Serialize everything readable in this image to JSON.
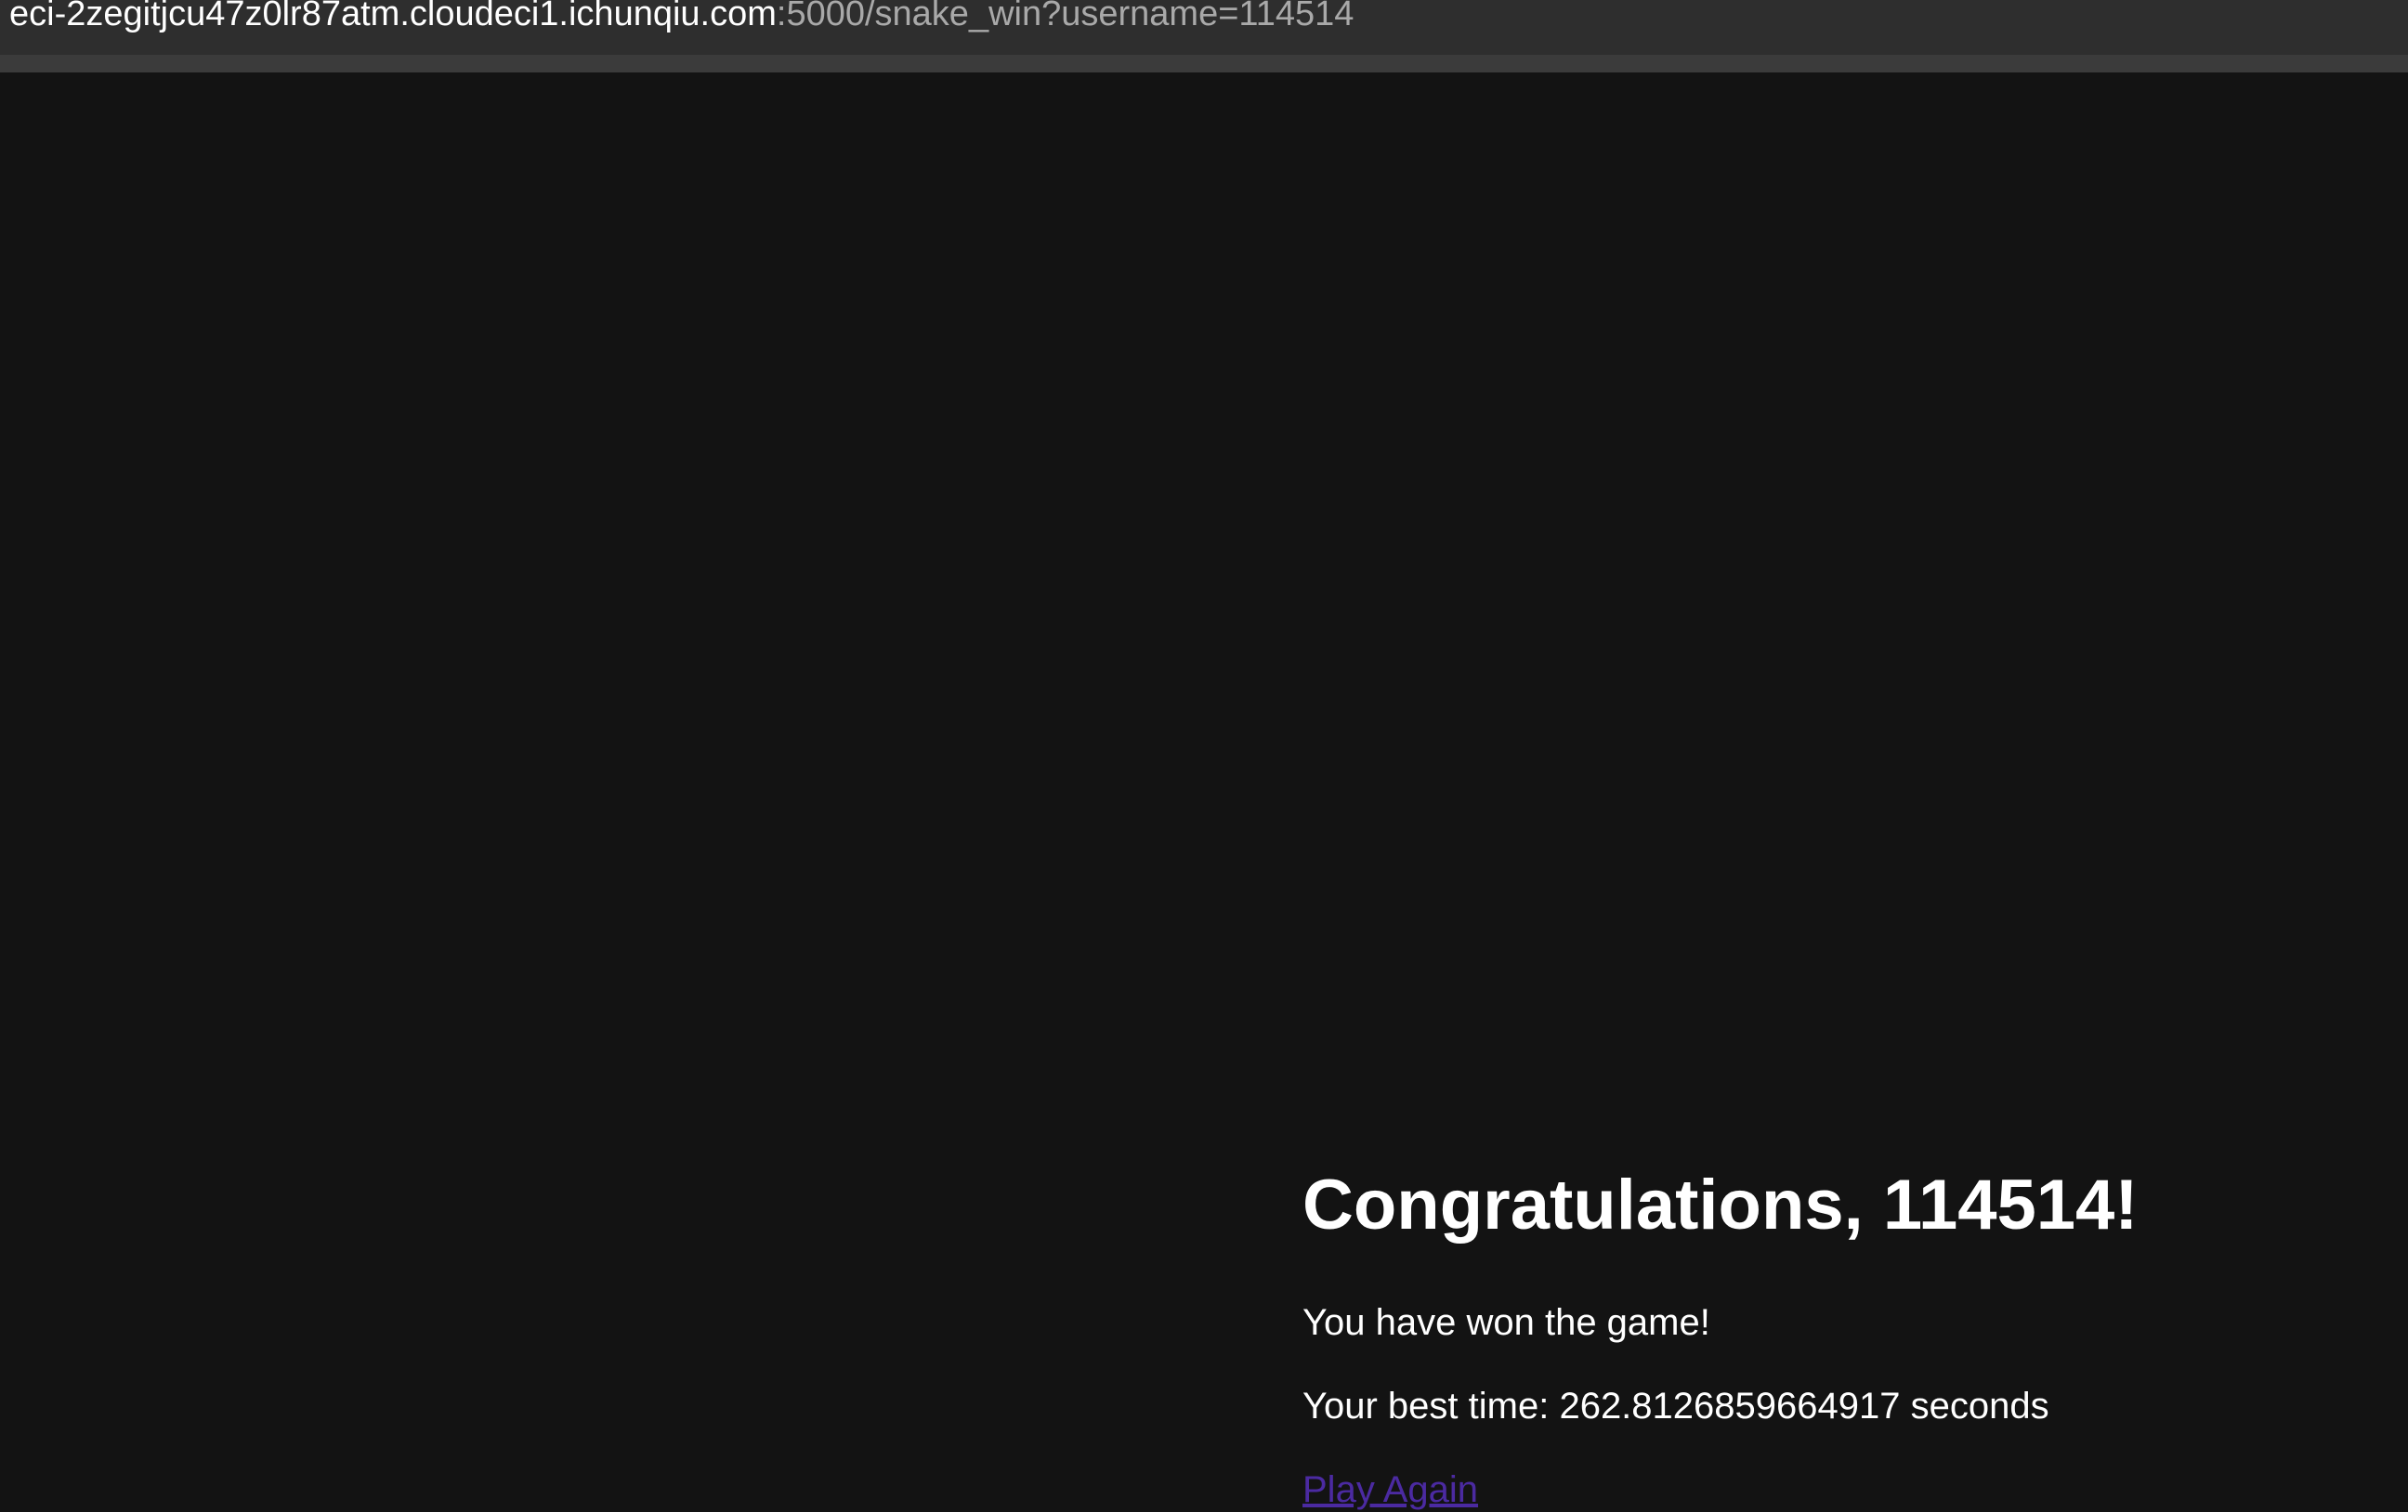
{
  "browser": {
    "url_host": "eci-2zegitjcu47z0lr87atm.cloudeci1.ichunqiu.com",
    "url_path": ":5000/snake_win?username=114514"
  },
  "win_page": {
    "title": "Congratulations, 114514!",
    "won_message": "You have won the game!",
    "best_time": "Your best time: 262.8126859664917 seconds",
    "play_again_label": "Play Again"
  },
  "colors": {
    "page_background": "#131313",
    "text": "#ffffff",
    "link_visited": "#4b2aa1",
    "address_bar": "#2e2e2e"
  }
}
